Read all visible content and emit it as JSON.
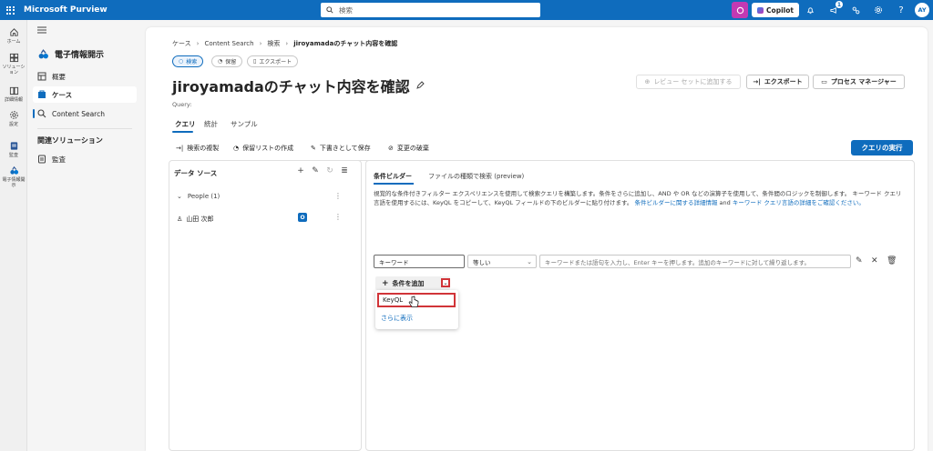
{
  "topbar": {
    "app_title": "Microsoft Purview",
    "search_placeholder": "検索",
    "copilot_label": "Copilot",
    "notification_count": "1",
    "avatar_initials": "AY"
  },
  "rail": [
    {
      "label": "ホーム",
      "icon": "home-icon"
    },
    {
      "label": "ソリューション",
      "icon": "grid-icon"
    },
    {
      "label": "詳細情報",
      "icon": "book-icon"
    },
    {
      "label": "設定",
      "icon": "gear-icon"
    },
    {
      "label": "監査",
      "icon": "audit-icon"
    },
    {
      "label": "電子情報開示",
      "icon": "ediscovery-icon"
    }
  ],
  "leftnav": {
    "title": "電子情報開示",
    "items": [
      {
        "label": "概要",
        "icon": "overview-icon"
      },
      {
        "label": "ケース",
        "icon": "case-icon"
      },
      {
        "label": "Content Search",
        "icon": "search-icon"
      }
    ],
    "related_title": "関連ソリューション",
    "related_items": [
      {
        "label": "監査",
        "icon": "audit-icon"
      }
    ]
  },
  "breadcrumb": [
    "ケース",
    "Content Search",
    "検索",
    "jiroyamadaのチャット内容を確認"
  ],
  "pills": [
    "検索",
    "保留",
    "エクスポート"
  ],
  "page": {
    "title": "jiroyamadaのチャット内容を確認",
    "query_label": "Query:",
    "review_btn": "レビュー セットに追加する",
    "export_btn": "エクスポート",
    "process_btn": "プロセス マネージャー"
  },
  "tabs": [
    "クエリ",
    "統計",
    "サンプル"
  ],
  "toolbar": {
    "duplicate": "検索の複製",
    "hold": "保留リストの作成",
    "save_draft": "下書きとして保存",
    "discard": "変更の破棄",
    "run": "クエリの実行"
  },
  "datasource": {
    "title": "データ ソース",
    "group": "People (1)",
    "person": "山田 次郎"
  },
  "builder": {
    "tabs": [
      "条件ビルダー",
      "ファイルの種類で検索 (preview)"
    ],
    "desc_1": "視覚的な条件付きフィルター エクスペリエンスを使用して検索クエリを構築します。条件をさらに追加し、AND や OR などの演算子を使用して、条件間のロジックを制御します。",
    "desc_2": "キーワード クエリ言語を使用するには、KeyQL をコピーして、KeyQL フィールドの下のビルダーに貼り付けます。",
    "desc_link_1": "条件ビルダーに関する詳細情報",
    "desc_and": "and",
    "desc_link_2": "キーワード クエリ言語の詳細をご確認ください。",
    "field_keyword": "キーワード",
    "field_operator": "等しい",
    "field_value_placeholder": "キーワードまたは語句を入力し、Enter キーを押します。追加のキーワードに対して繰り返します。",
    "add_condition": "条件を追加",
    "menu_keyql": "KeyQL",
    "menu_more": "さらに表示"
  }
}
